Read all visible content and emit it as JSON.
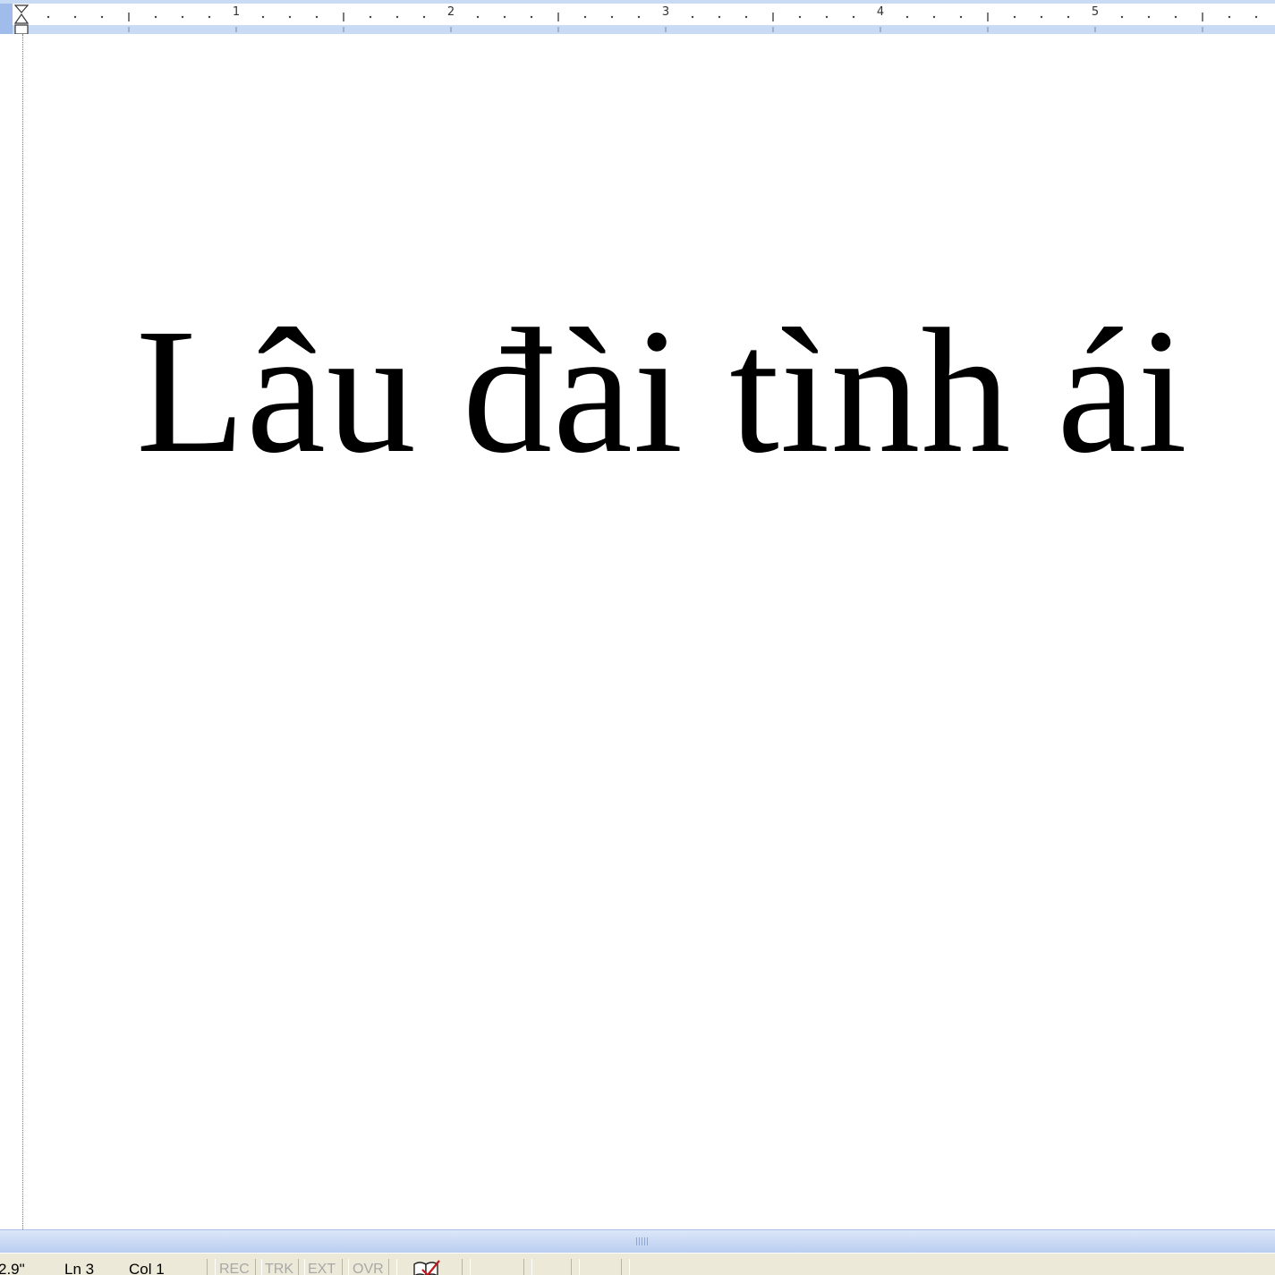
{
  "ruler": {
    "unit": "inches",
    "numbers": [
      "1",
      "2",
      "3",
      "4",
      "5"
    ]
  },
  "document": {
    "title": "Lâu đài tình ái"
  },
  "statusbar": {
    "position_at": "2.9\"",
    "line": "Ln 3",
    "column": "Col 1",
    "modes": [
      "REC",
      "TRK",
      "EXT",
      "OVR"
    ],
    "spelling_icon": "book-check-icon"
  },
  "colors": {
    "ruler_band": "#c9daf5",
    "splitter": "#b9cdf0",
    "statusbar": "#ece9d8",
    "text": "#000000",
    "inactive_mode_text": "#a8a8a8"
  }
}
